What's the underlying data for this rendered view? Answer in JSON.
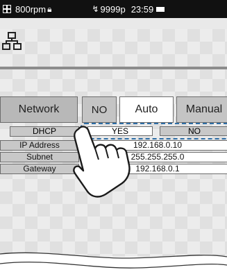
{
  "status_bar": {
    "rpm": "800rpm",
    "lock_icon": "lock-icon",
    "pulse_icon": "pulse-icon",
    "pulse_count": "9999p",
    "time": "23:59",
    "battery_icon": "battery-icon"
  },
  "header": {
    "network_icon": "network-icon"
  },
  "settings": {
    "category_label": "Network",
    "mode_options": [
      "NO",
      "Auto",
      "Manual"
    ],
    "selected_mode": "Auto",
    "dhcp": {
      "label": "DHCP",
      "options": [
        "YES",
        "NO"
      ],
      "selected": "YES"
    },
    "rows": [
      {
        "label": "IP Address",
        "value": "192.168.0.10"
      },
      {
        "label": "Subnet",
        "value": "255.255.255.0"
      },
      {
        "label": "Gateway",
        "value": "192.168.0.1"
      }
    ]
  },
  "colors": {
    "highlight": "#2e6ea6",
    "status_bar": "#111111",
    "selected_button": "#ffffff"
  },
  "overlay": {
    "hand_icon": "pointing-hand-icon"
  }
}
